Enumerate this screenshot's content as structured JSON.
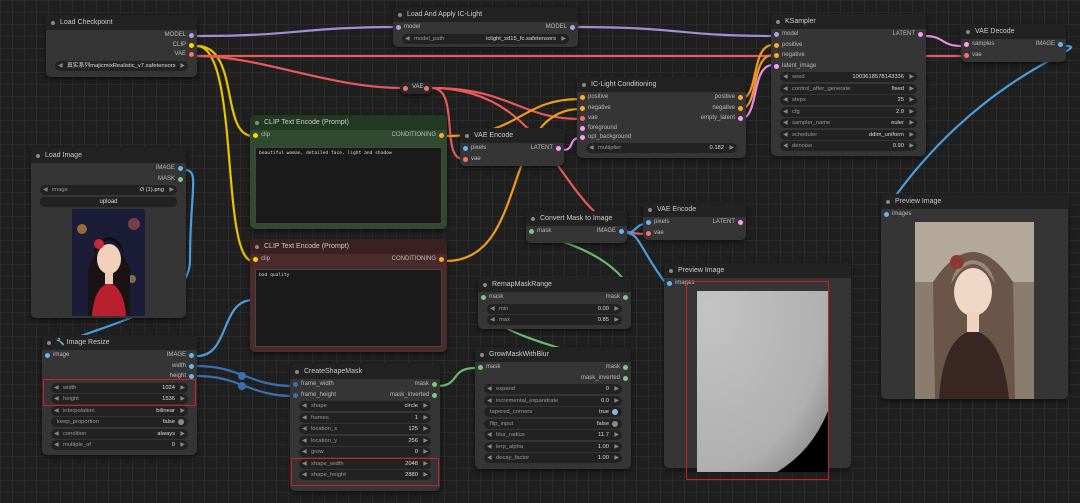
{
  "nodes": {
    "load_checkpoint": {
      "title": "Load Checkpoint",
      "outputs": [
        "MODEL",
        "CLIP",
        "VAE"
      ],
      "ckpt_value": "真实系列majicmixRealistic_v7.safetensors"
    },
    "load_iclight": {
      "title": "Load And Apply IC-Light",
      "input": "model",
      "output": "MODEL",
      "widget_label": "model_path",
      "widget_value": "iclight_sd15_fc.safetensors"
    },
    "ksampler": {
      "title": "KSampler",
      "inputs": [
        "model",
        "positive",
        "negative",
        "latent_image"
      ],
      "output": "LATENT",
      "widgets": [
        [
          "seed",
          "1003618578143336"
        ],
        [
          "control_after_generate",
          "fixed"
        ],
        [
          "steps",
          "25"
        ],
        [
          "cfg",
          "2.0"
        ],
        [
          "sampler_name",
          "euler"
        ],
        [
          "scheduler",
          "ddim_uniform"
        ],
        [
          "denoise",
          "0.90"
        ]
      ]
    },
    "vae_decode": {
      "title": "VAE Decode",
      "inputs": [
        "samples",
        "vae"
      ],
      "output": "IMAGE"
    },
    "vae_reroute": {
      "label": "VAE"
    },
    "iclight_cond": {
      "title": "IC-Light Conditioning",
      "inputs": [
        "positive",
        "negative",
        "vae",
        "foreground",
        "opt_background"
      ],
      "outputs": [
        "positive",
        "negative",
        "empty_latent"
      ],
      "widget_label": "multiplier",
      "widget_value": "0.182"
    },
    "clip_pos": {
      "title": "CLIP Text Encode (Prompt)",
      "input": "clip",
      "output": "CONDITIONING",
      "text": "beautiful woman, detailed face, light and shadow"
    },
    "clip_neg": {
      "title": "CLIP Text Encode (Prompt)",
      "input": "clip",
      "output": "CONDITIONING",
      "text": "bad quality"
    },
    "vae_encode1": {
      "title": "VAE Encode",
      "inputs": [
        "pixels",
        "vae"
      ],
      "output": "LATENT"
    },
    "load_image": {
      "title": "Load Image",
      "outputs": [
        "IMAGE",
        "MASK"
      ],
      "widget_label": "image",
      "widget_value": "i3 (1).png",
      "upload": "upload"
    },
    "image_resize": {
      "title": "🔧 Image Resize",
      "input": "image",
      "outputs": [
        "IMAGE",
        "width",
        "height"
      ],
      "widgets": [
        [
          "width",
          "1024"
        ],
        [
          "height",
          "1536"
        ],
        [
          "interpolation",
          "bilinear"
        ],
        [
          "keep_proportion",
          "false"
        ],
        [
          "condition",
          "always"
        ],
        [
          "multiple_of",
          "0"
        ]
      ]
    },
    "convert_mask": {
      "title": "Convert Mask to Image",
      "input": "mask",
      "output": "IMAGE"
    },
    "vae_encode2": {
      "title": "VAE Encode",
      "inputs": [
        "pixels",
        "vae"
      ],
      "output": "LATENT"
    },
    "preview1": {
      "title": "Preview Image",
      "input": "images"
    },
    "preview2": {
      "title": "Preview Image",
      "input": "images"
    },
    "remap": {
      "title": "RemapMaskRange",
      "input": "mask",
      "output": "mask",
      "widgets": [
        [
          "min",
          "0.00"
        ],
        [
          "max",
          "0.85"
        ]
      ]
    },
    "create_shape": {
      "title": "CreateShapeMask",
      "inputs": [
        "frame_width",
        "frame_height"
      ],
      "outputs": [
        "mask",
        "mask_inverted"
      ],
      "widgets": [
        [
          "shape",
          "circle"
        ],
        [
          "frames",
          "1"
        ],
        [
          "location_x",
          "125"
        ],
        [
          "location_y",
          "256"
        ],
        [
          "grow",
          "0"
        ],
        [
          "shape_width",
          "2048"
        ],
        [
          "shape_height",
          "2880"
        ]
      ]
    },
    "grow_mask": {
      "title": "GrowMaskWithBlur",
      "input": "mask",
      "outputs": [
        "mask",
        "mask_inverted"
      ],
      "widgets": [
        [
          "expand",
          "0"
        ],
        [
          "incremental_expandrate",
          "0.0"
        ],
        [
          "tapered_corners",
          "true"
        ],
        [
          "flip_input",
          "false"
        ],
        [
          "blur_radius",
          "11.7"
        ],
        [
          "lerp_alpha",
          "1.00"
        ],
        [
          "decay_factor",
          "1.00"
        ]
      ]
    }
  },
  "colors": {
    "model": "#b39ddb",
    "clip": "#ffd500",
    "vae": "#ff6e6e",
    "conditioning": "#ffa931",
    "latent": "#ff9cf9",
    "image": "#64b5f6",
    "mask": "#81c784",
    "highlight": "#d41a24"
  }
}
